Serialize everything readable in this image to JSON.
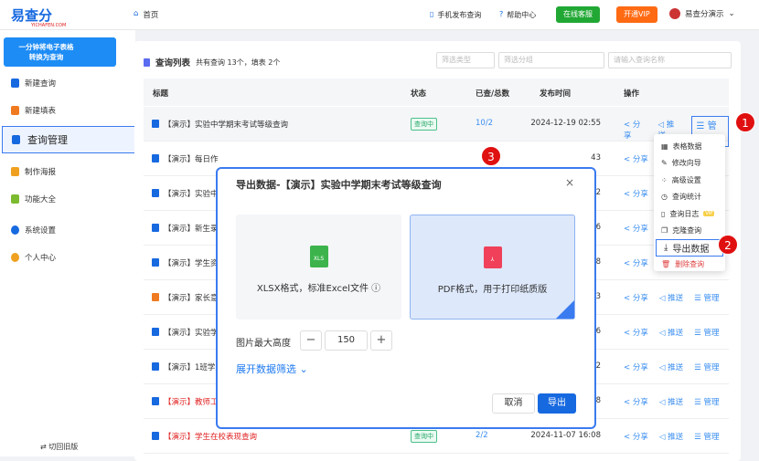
{
  "header": {
    "logo": "易查分",
    "logo_sub": "YICHAFEN.COM",
    "home": "首页",
    "mobile": "手机发布查询",
    "help": "帮助中心",
    "service": "在线客服",
    "vip": "开通VIP",
    "user": "易查分演示"
  },
  "sidebar": {
    "promo_line1": "一分钟将电子表格",
    "promo_line2": "转换为查询",
    "items": [
      {
        "label": "新建查询"
      },
      {
        "label": "新建填表"
      },
      {
        "label": "查询管理"
      },
      {
        "label": "制作海报"
      },
      {
        "label": "功能大全"
      },
      {
        "label": "系统设置"
      },
      {
        "label": "个人中心"
      }
    ],
    "switch": "切回旧版"
  },
  "list": {
    "title": "查询列表",
    "summary": "共有查询 13个，填表 2个",
    "filter_type": "筛选类型",
    "filter_group": "筛选分组",
    "search_placeholder": "请输入查询名称"
  },
  "table": {
    "headers": [
      "标题",
      "状态",
      "已查/总数",
      "发布时间",
      "操作"
    ],
    "rows": [
      {
        "title": "【演示】实验中学期末考试等级查询",
        "status": "查询中",
        "count": "10/2",
        "time": "2024-12-19 02:55"
      },
      {
        "title": "【演示】每日作",
        "time": "43"
      },
      {
        "title": "【演示】实验中",
        "time": "02"
      },
      {
        "title": "【演示】新生录",
        "time": "36"
      },
      {
        "title": "【演示】学生资",
        "time": "48"
      },
      {
        "title": "【演示】家长意",
        "time": "33"
      },
      {
        "title": "【演示】实验学",
        "time": "06"
      },
      {
        "title": "【演示】1班学生",
        "time": "12"
      },
      {
        "title": "【演示】教师工",
        "time": "08"
      },
      {
        "title": "【演示】学生在校表现查询",
        "status": "查询中",
        "count": "2/2",
        "time": "2024-11-07 16:08"
      }
    ],
    "ops": {
      "share": "分享",
      "push": "推送",
      "manage": "管理"
    }
  },
  "menu": {
    "items": [
      "表格数据",
      "修改向导",
      "高级设置",
      "查询统计",
      "查询日志",
      "克隆查询",
      "导出数据",
      "删除查询"
    ],
    "vip_tag": "VIP"
  },
  "modal": {
    "title": "导出数据-【演示】实验中学期末考试等级查询",
    "xlsx_label": "XLSX格式，标准Excel文件",
    "xlsx_icon": "XLS",
    "pdf_label": "PDF格式，用于打印纸质版",
    "img_height_label": "图片最大高度",
    "img_height_value": "150",
    "expand_filter": "展开数据筛选",
    "cancel": "取消",
    "export": "导出",
    "selected": "pdf"
  },
  "annotations": [
    "1",
    "2",
    "3"
  ],
  "colors": {
    "primary": "#1769e0",
    "accent": "#3a7bf0",
    "danger": "#e01010",
    "service": "#21a834",
    "vip": "#ff6a13"
  }
}
